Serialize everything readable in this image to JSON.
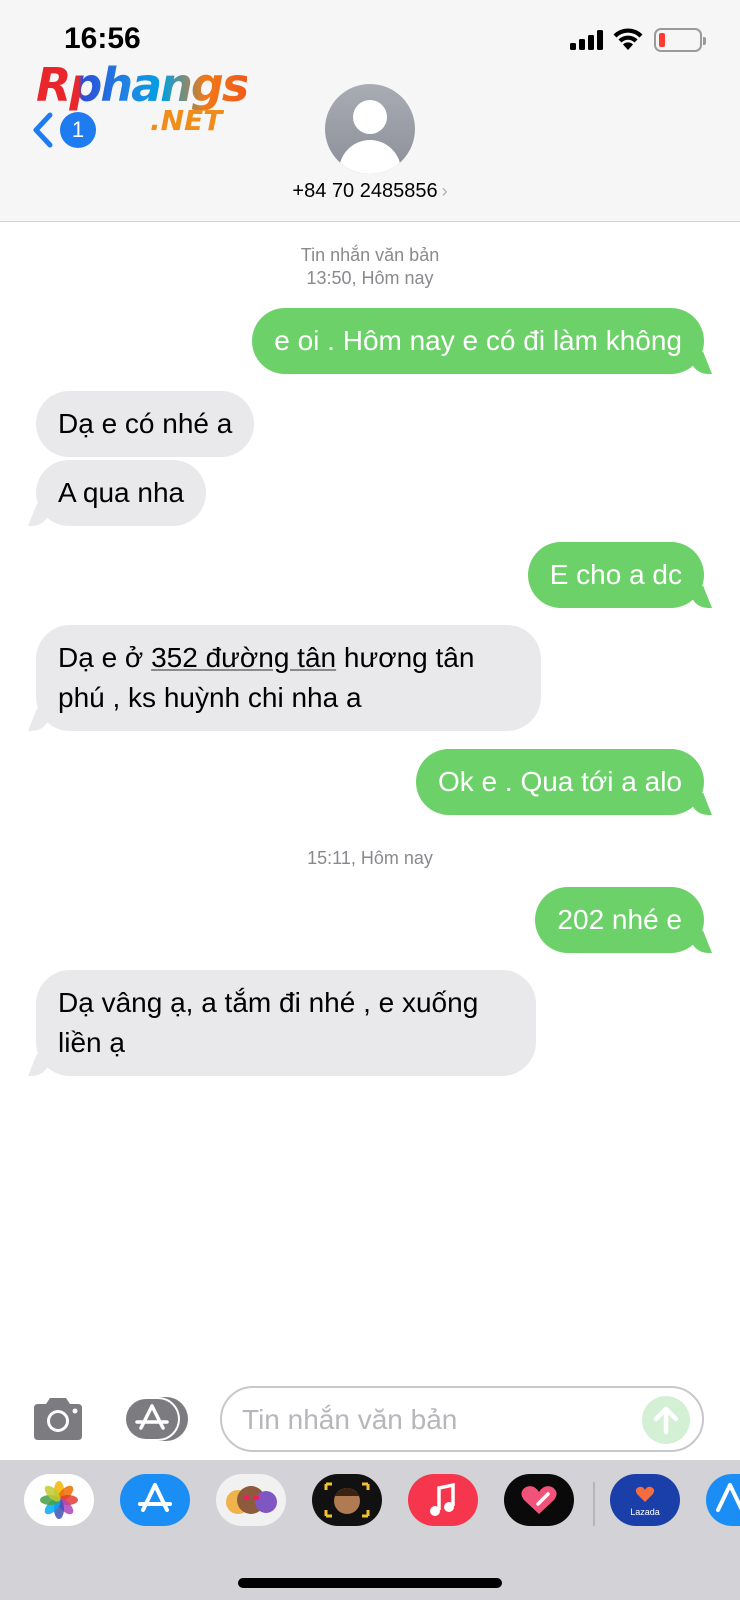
{
  "status_bar": {
    "time": "16:56"
  },
  "header": {
    "logo_main": "Rphangs",
    "logo_net": ".NET",
    "back_badge": "1",
    "contact_number": "+84 70 2485856",
    "contact_chevron": "›"
  },
  "conversation": {
    "timestamp_1": {
      "label": "Tin nhắn văn bản",
      "time": "13:50, Hôm nay"
    },
    "messages": [
      {
        "direction": "sent",
        "text": "e oi . Hôm nay e có đi làm không"
      },
      {
        "direction": "received",
        "text": "Dạ e có nhé a"
      },
      {
        "direction": "received",
        "text": "A qua nha"
      },
      {
        "direction": "sent",
        "text": "E cho a dc"
      },
      {
        "direction": "received",
        "text_pre": "Dạ e ở ",
        "text_link": "352 đường tân",
        "text_post": " hương   tân phú , ks huỳnh chi nha a"
      },
      {
        "direction": "sent",
        "text": "Ok e . Qua tới a alo"
      },
      {
        "direction": "sent",
        "text": "202 nhé e"
      },
      {
        "direction": "received",
        "text": "Dạ vâng ạ, a tắm đi nhé , e xuống liền ạ"
      }
    ],
    "timestamp_2": {
      "time": "15:11, Hôm nay"
    }
  },
  "composer": {
    "placeholder": "Tin nhắn văn bản",
    "camera_icon": "camera-icon",
    "apps_icon": "app-store-icon",
    "send_icon": "arrow-up-icon"
  },
  "app_drawer": {
    "apps": [
      "Photos",
      "App Store",
      "Memoji Stickers",
      "Animoji",
      "Music",
      "Digital Touch",
      "Lazada",
      "App Store"
    ],
    "lazada_label": "Lazada"
  },
  "colors": {
    "sent_bubble": "#6dd16a",
    "received_bubble": "#e9e9eb",
    "accent_blue": "#1f7cf0"
  }
}
